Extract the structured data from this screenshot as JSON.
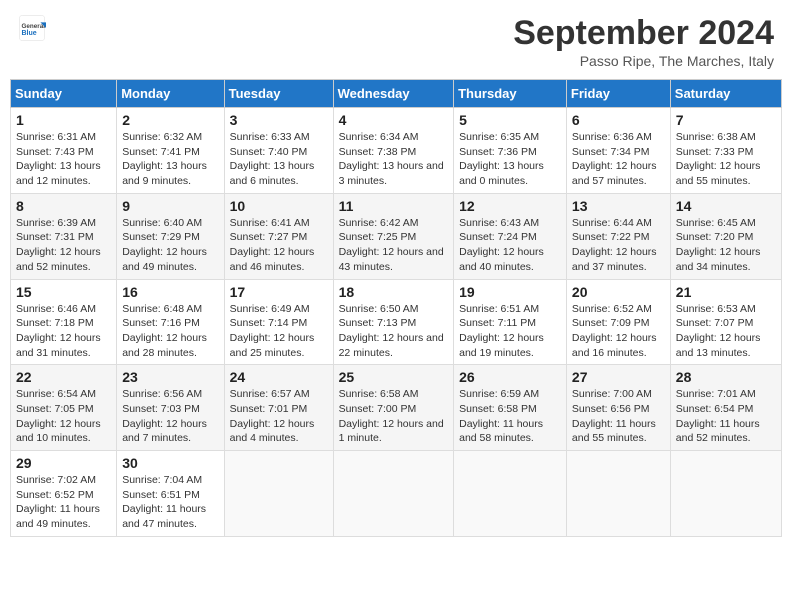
{
  "header": {
    "logo_general": "General",
    "logo_blue": "Blue",
    "month_title": "September 2024",
    "subtitle": "Passo Ripe, The Marches, Italy"
  },
  "days_of_week": [
    "Sunday",
    "Monday",
    "Tuesday",
    "Wednesday",
    "Thursday",
    "Friday",
    "Saturday"
  ],
  "weeks": [
    [
      {
        "day": "1",
        "sunrise": "Sunrise: 6:31 AM",
        "sunset": "Sunset: 7:43 PM",
        "daylight": "Daylight: 13 hours and 12 minutes."
      },
      {
        "day": "2",
        "sunrise": "Sunrise: 6:32 AM",
        "sunset": "Sunset: 7:41 PM",
        "daylight": "Daylight: 13 hours and 9 minutes."
      },
      {
        "day": "3",
        "sunrise": "Sunrise: 6:33 AM",
        "sunset": "Sunset: 7:40 PM",
        "daylight": "Daylight: 13 hours and 6 minutes."
      },
      {
        "day": "4",
        "sunrise": "Sunrise: 6:34 AM",
        "sunset": "Sunset: 7:38 PM",
        "daylight": "Daylight: 13 hours and 3 minutes."
      },
      {
        "day": "5",
        "sunrise": "Sunrise: 6:35 AM",
        "sunset": "Sunset: 7:36 PM",
        "daylight": "Daylight: 13 hours and 0 minutes."
      },
      {
        "day": "6",
        "sunrise": "Sunrise: 6:36 AM",
        "sunset": "Sunset: 7:34 PM",
        "daylight": "Daylight: 12 hours and 57 minutes."
      },
      {
        "day": "7",
        "sunrise": "Sunrise: 6:38 AM",
        "sunset": "Sunset: 7:33 PM",
        "daylight": "Daylight: 12 hours and 55 minutes."
      }
    ],
    [
      {
        "day": "8",
        "sunrise": "Sunrise: 6:39 AM",
        "sunset": "Sunset: 7:31 PM",
        "daylight": "Daylight: 12 hours and 52 minutes."
      },
      {
        "day": "9",
        "sunrise": "Sunrise: 6:40 AM",
        "sunset": "Sunset: 7:29 PM",
        "daylight": "Daylight: 12 hours and 49 minutes."
      },
      {
        "day": "10",
        "sunrise": "Sunrise: 6:41 AM",
        "sunset": "Sunset: 7:27 PM",
        "daylight": "Daylight: 12 hours and 46 minutes."
      },
      {
        "day": "11",
        "sunrise": "Sunrise: 6:42 AM",
        "sunset": "Sunset: 7:25 PM",
        "daylight": "Daylight: 12 hours and 43 minutes."
      },
      {
        "day": "12",
        "sunrise": "Sunrise: 6:43 AM",
        "sunset": "Sunset: 7:24 PM",
        "daylight": "Daylight: 12 hours and 40 minutes."
      },
      {
        "day": "13",
        "sunrise": "Sunrise: 6:44 AM",
        "sunset": "Sunset: 7:22 PM",
        "daylight": "Daylight: 12 hours and 37 minutes."
      },
      {
        "day": "14",
        "sunrise": "Sunrise: 6:45 AM",
        "sunset": "Sunset: 7:20 PM",
        "daylight": "Daylight: 12 hours and 34 minutes."
      }
    ],
    [
      {
        "day": "15",
        "sunrise": "Sunrise: 6:46 AM",
        "sunset": "Sunset: 7:18 PM",
        "daylight": "Daylight: 12 hours and 31 minutes."
      },
      {
        "day": "16",
        "sunrise": "Sunrise: 6:48 AM",
        "sunset": "Sunset: 7:16 PM",
        "daylight": "Daylight: 12 hours and 28 minutes."
      },
      {
        "day": "17",
        "sunrise": "Sunrise: 6:49 AM",
        "sunset": "Sunset: 7:14 PM",
        "daylight": "Daylight: 12 hours and 25 minutes."
      },
      {
        "day": "18",
        "sunrise": "Sunrise: 6:50 AM",
        "sunset": "Sunset: 7:13 PM",
        "daylight": "Daylight: 12 hours and 22 minutes."
      },
      {
        "day": "19",
        "sunrise": "Sunrise: 6:51 AM",
        "sunset": "Sunset: 7:11 PM",
        "daylight": "Daylight: 12 hours and 19 minutes."
      },
      {
        "day": "20",
        "sunrise": "Sunrise: 6:52 AM",
        "sunset": "Sunset: 7:09 PM",
        "daylight": "Daylight: 12 hours and 16 minutes."
      },
      {
        "day": "21",
        "sunrise": "Sunrise: 6:53 AM",
        "sunset": "Sunset: 7:07 PM",
        "daylight": "Daylight: 12 hours and 13 minutes."
      }
    ],
    [
      {
        "day": "22",
        "sunrise": "Sunrise: 6:54 AM",
        "sunset": "Sunset: 7:05 PM",
        "daylight": "Daylight: 12 hours and 10 minutes."
      },
      {
        "day": "23",
        "sunrise": "Sunrise: 6:56 AM",
        "sunset": "Sunset: 7:03 PM",
        "daylight": "Daylight: 12 hours and 7 minutes."
      },
      {
        "day": "24",
        "sunrise": "Sunrise: 6:57 AM",
        "sunset": "Sunset: 7:01 PM",
        "daylight": "Daylight: 12 hours and 4 minutes."
      },
      {
        "day": "25",
        "sunrise": "Sunrise: 6:58 AM",
        "sunset": "Sunset: 7:00 PM",
        "daylight": "Daylight: 12 hours and 1 minute."
      },
      {
        "day": "26",
        "sunrise": "Sunrise: 6:59 AM",
        "sunset": "Sunset: 6:58 PM",
        "daylight": "Daylight: 11 hours and 58 minutes."
      },
      {
        "day": "27",
        "sunrise": "Sunrise: 7:00 AM",
        "sunset": "Sunset: 6:56 PM",
        "daylight": "Daylight: 11 hours and 55 minutes."
      },
      {
        "day": "28",
        "sunrise": "Sunrise: 7:01 AM",
        "sunset": "Sunset: 6:54 PM",
        "daylight": "Daylight: 11 hours and 52 minutes."
      }
    ],
    [
      {
        "day": "29",
        "sunrise": "Sunrise: 7:02 AM",
        "sunset": "Sunset: 6:52 PM",
        "daylight": "Daylight: 11 hours and 49 minutes."
      },
      {
        "day": "30",
        "sunrise": "Sunrise: 7:04 AM",
        "sunset": "Sunset: 6:51 PM",
        "daylight": "Daylight: 11 hours and 47 minutes."
      },
      null,
      null,
      null,
      null,
      null
    ]
  ]
}
